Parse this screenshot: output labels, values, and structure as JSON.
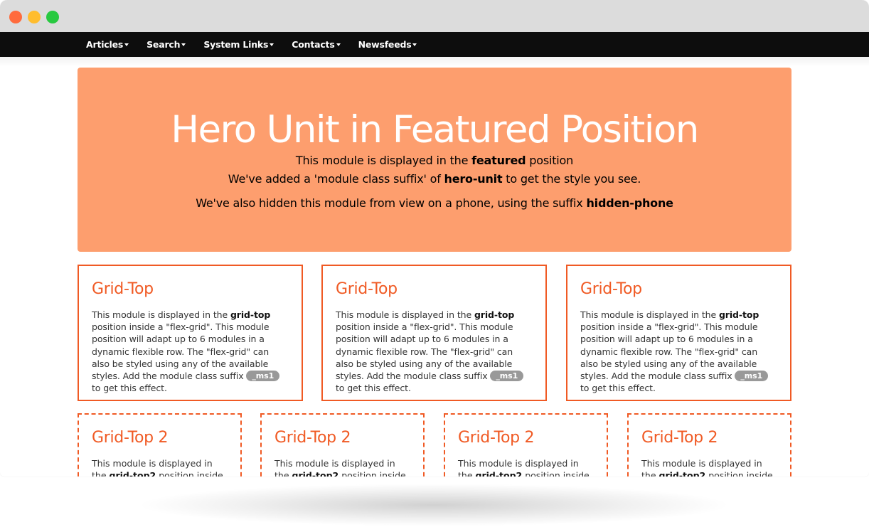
{
  "window_controls": [
    "close",
    "minimize",
    "maximize"
  ],
  "nav": {
    "items": [
      {
        "label": "Articles"
      },
      {
        "label": "Search"
      },
      {
        "label": "System Links"
      },
      {
        "label": "Contacts"
      },
      {
        "label": "Newsfeeds"
      }
    ]
  },
  "hero": {
    "title": "Hero Unit in Featured Position",
    "line1_pre": "This module is displayed in the ",
    "line1_bold": "featured",
    "line1_post": " position",
    "line2_pre": "We've added a 'module class suffix' of ",
    "line2_bold": "hero-unit",
    "line2_post": " to get the style you see.",
    "line3_pre": "We've also hidden this module from view on a phone, using the suffix ",
    "line3_bold": "hidden-phone",
    "background": "#fd9e6e"
  },
  "grid_top": {
    "cards": [
      {
        "title": "Grid-Top",
        "text_pre": "This module is displayed in the ",
        "text_bold": "grid-top",
        "text_mid": " position inside a \"flex-grid\". This module position will adapt up to 6 modules in a dynamic flexible row. The \"flex-grid\" can also be styled using any of the available styles. Add the module class suffix ",
        "badge": "_ms1",
        "text_post": " to get this effect."
      },
      {
        "title": "Grid-Top",
        "text_pre": "This module is displayed in the ",
        "text_bold": "grid-top",
        "text_mid": " position inside a \"flex-grid\". This module position will adapt up to 6 modules in a dynamic flexible row. The \"flex-grid\" can also be styled using any of the available styles. Add the module class suffix ",
        "badge": "_ms1",
        "text_post": " to get this effect."
      },
      {
        "title": "Grid-Top",
        "text_pre": "This module is displayed in the ",
        "text_bold": "grid-top",
        "text_mid": " position inside a \"flex-grid\". This module position will adapt up to 6 modules in a dynamic flexible row. The \"flex-grid\" can also be styled using any of the available styles. Add the module class suffix ",
        "badge": "_ms1",
        "text_post": " to get this effect."
      }
    ]
  },
  "grid_top2": {
    "cards": [
      {
        "title": "Grid-Top 2",
        "text_pre": "This module is displayed in the ",
        "text_bold": "grid-top2",
        "text_post": " position inside a \"flex-"
      },
      {
        "title": "Grid-Top 2",
        "text_pre": "This module is displayed in the ",
        "text_bold": "grid-top2",
        "text_post": " position inside a \"flex-"
      },
      {
        "title": "Grid-Top 2",
        "text_pre": "This module is displayed in the ",
        "text_bold": "grid-top2",
        "text_post": " position inside a \"flex-"
      },
      {
        "title": "Grid-Top 2",
        "text_pre": "This module is displayed in the ",
        "text_bold": "grid-top2",
        "text_post": " position inside a \"flex-"
      }
    ]
  },
  "colors": {
    "accent": "#f05a24",
    "navbar": "#0d0d0d",
    "badge": "#999999"
  }
}
